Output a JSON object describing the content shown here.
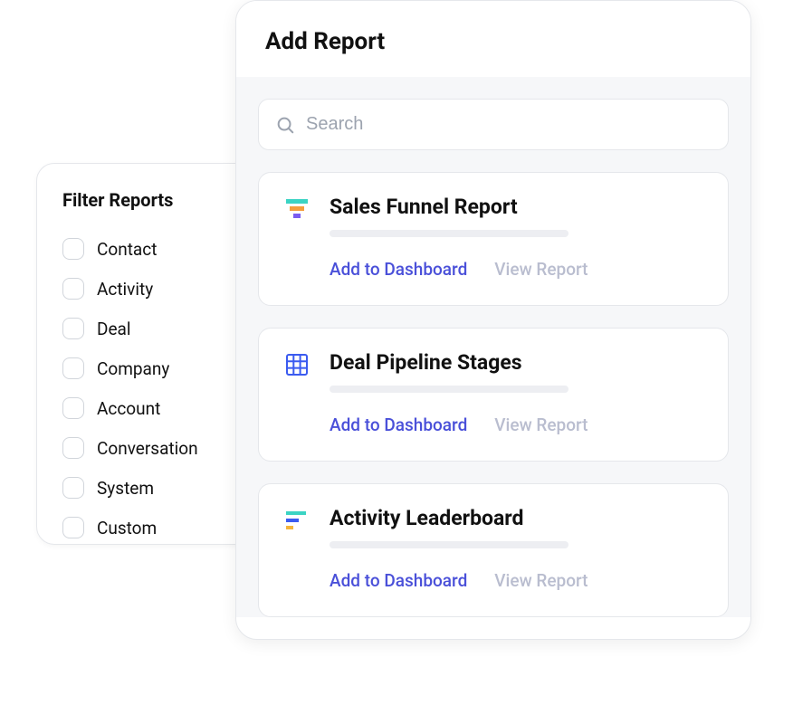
{
  "filter": {
    "title": "Filter Reports",
    "items": [
      {
        "label": "Contact"
      },
      {
        "label": "Activity"
      },
      {
        "label": "Deal"
      },
      {
        "label": "Company"
      },
      {
        "label": "Account"
      },
      {
        "label": "Conversation"
      },
      {
        "label": "System"
      },
      {
        "label": "Custom"
      }
    ]
  },
  "panel": {
    "title": "Add Report",
    "search_placeholder": "Search"
  },
  "reports": [
    {
      "title": "Sales Funnel Report",
      "add_label": "Add to Dashboard",
      "view_label": "View Report"
    },
    {
      "title": "Deal Pipeline Stages",
      "add_label": "Add to Dashboard",
      "view_label": "View Report"
    },
    {
      "title": "Activity Leaderboard",
      "add_label": "Add to Dashboard",
      "view_label": "View Report"
    }
  ]
}
